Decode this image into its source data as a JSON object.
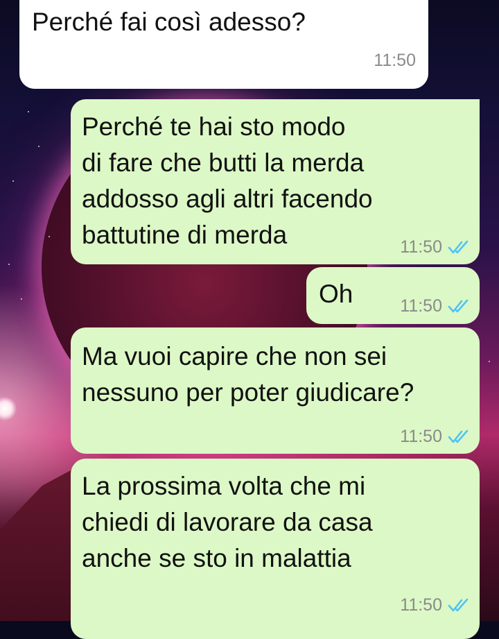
{
  "chat": {
    "messages": [
      {
        "direction": "incoming",
        "text": "Perché fai così adesso?",
        "time": "11:50"
      },
      {
        "direction": "outgoing",
        "text": "Perché te hai sto modo\ndi fare che butti la merda\naddosso agli altri facendo\nbattutine di merda",
        "time": "11:50",
        "status": "double-check-icon"
      },
      {
        "direction": "outgoing",
        "text": "Oh",
        "time": "11:50",
        "status": "double-check-icon"
      },
      {
        "direction": "outgoing",
        "text": "Ma vuoi capire che non sei\nnessuno per poter giudicare?",
        "time": "11:50",
        "status": "double-check-icon"
      },
      {
        "direction": "outgoing",
        "text": "La prossima volta che mi\nchiedi di lavorare da casa\nanche se sto in malattia",
        "time": "11:50",
        "status": "double-check-icon"
      }
    ]
  },
  "colors": {
    "incoming_bubble": "#ffffff",
    "outgoing_bubble": "#dcf8c6",
    "read_tick": "#4fc3f7"
  }
}
